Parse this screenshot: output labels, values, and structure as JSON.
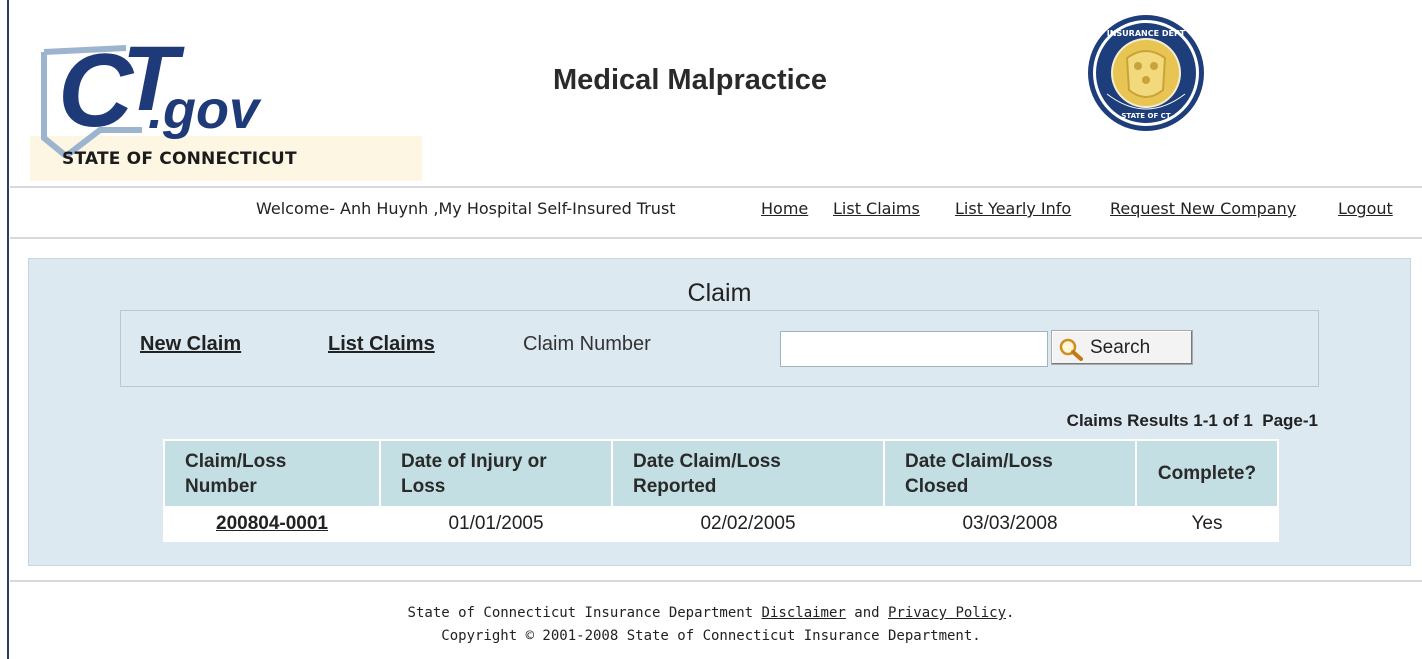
{
  "header": {
    "logo_text": "CT.gov",
    "logo_state": "STATE OF CONNECTICUT",
    "app_title": "Medical Malpractice",
    "seal_text": "INSURANCE DEPARTMENT STATE OF CONNECTICUT"
  },
  "nav": {
    "welcome": "Welcome- Anh Huynh ,My Hospital Self-Insured Trust",
    "links": [
      "Home",
      "List Claims",
      "List Yearly Info",
      "Request New Company",
      "Logout"
    ]
  },
  "claim": {
    "title": "Claim",
    "new_claim": "New Claim",
    "list_claims": "List Claims",
    "claim_number_label": "Claim Number",
    "claim_number_value": "",
    "search_button": "Search",
    "results_info": "Claims Results 1-1 of 1  Page-1",
    "columns": [
      "Claim/Loss Number",
      "Date of Injury or Loss",
      "Date Claim/Loss Reported",
      "Date Claim/Loss Closed",
      "Complete?"
    ],
    "rows": [
      {
        "number": "200804-0001",
        "injury": "01/01/2005",
        "reported": "02/02/2005",
        "closed": "03/03/2008",
        "complete": "Yes"
      }
    ]
  },
  "footer": {
    "line1_prefix": "State of Connecticut Insurance Department",
    "disclaimer": "Disclaimer",
    "and": "and",
    "privacy": "Privacy Policy",
    "period": ".",
    "copyright": "Copyright © 2001-2008 State of Connecticut Insurance Department."
  },
  "colors": {
    "panel_bg": "#dce9f1",
    "table_header_bg": "#c3dfe3",
    "logo_blue": "#1f3a78",
    "seal_blue": "#1d3e7a",
    "seal_gold": "#e8c552"
  }
}
